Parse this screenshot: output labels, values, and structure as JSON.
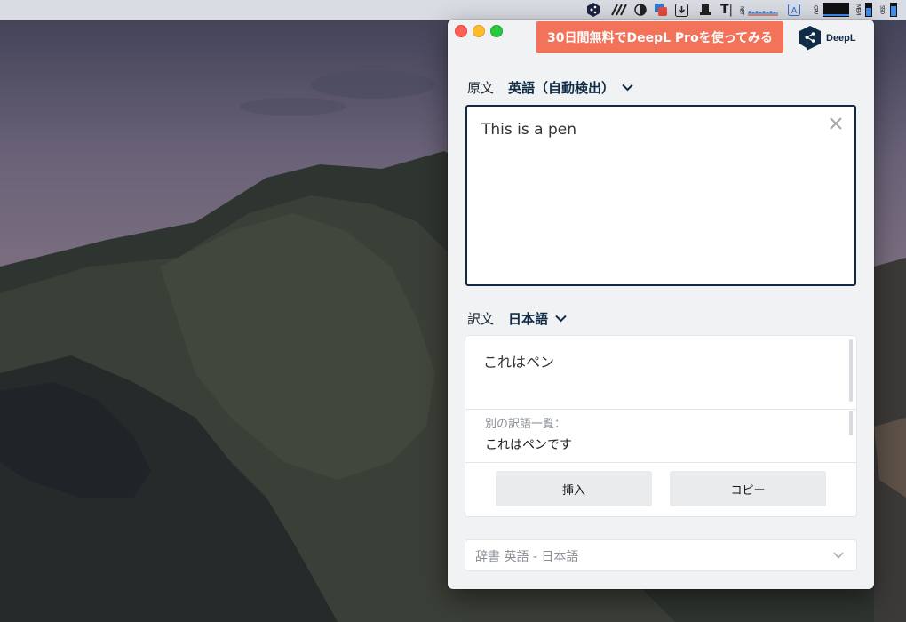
{
  "menubar": {
    "text_icon_label": "T",
    "net_label": "NET",
    "font_icon_label": "A",
    "cpu_label": "CPU",
    "mem_label": "MEM",
    "ssd_label": "SSD"
  },
  "window": {
    "promo_banner": "30日間無料でDeepL Proを使ってみる",
    "brand_name": "DeepL",
    "source": {
      "label": "原文",
      "language": "英語（自動検出）",
      "text": "This is a pen"
    },
    "target": {
      "label": "訳文",
      "language": "日本語",
      "text": "これはペン",
      "alternatives_title": "別の訳語一覧：",
      "alternatives": [
        "これはペンです"
      ],
      "insert_label": "挿入",
      "copy_label": "コピー"
    },
    "dictionary": {
      "label": "辞書 英語 - 日本語"
    }
  },
  "colors": {
    "accent": "#0f2b46",
    "promo": "#f2735a"
  }
}
